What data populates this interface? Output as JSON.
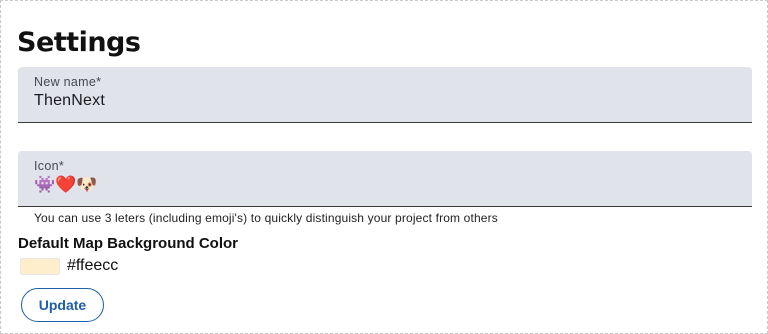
{
  "page": {
    "title": "Settings"
  },
  "name_field": {
    "label": "New name*",
    "value": "ThenNext"
  },
  "icon_field": {
    "label": "Icon*",
    "value": "👾❤️🐶",
    "helper": "You can use 3 leters (including emoji's) to quickly distinguish your project from others"
  },
  "map_background": {
    "label": "Default Map Background Color",
    "value": "#ffeecc"
  },
  "actions": {
    "update_label": "Update"
  },
  "colors": {
    "accent": "#1f5fa8",
    "field_bg": "#e1e3ea",
    "swatch": "#ffeecc"
  }
}
